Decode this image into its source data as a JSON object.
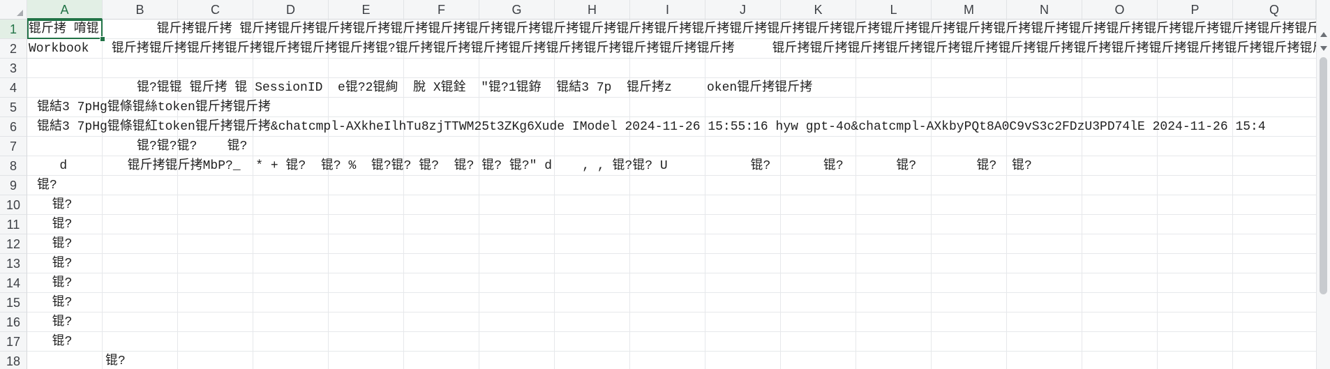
{
  "sheet": {
    "columns": [
      "A",
      "B",
      "C",
      "D",
      "E",
      "F",
      "G",
      "H",
      "I",
      "J",
      "K",
      "L",
      "M",
      "N",
      "O",
      "P",
      "Q"
    ],
    "rows": [
      "1",
      "2",
      "3",
      "4",
      "5",
      "6",
      "7",
      "8",
      "9",
      "10",
      "11",
      "12",
      "13",
      "14",
      "15",
      "16",
      "17",
      "18"
    ],
    "active_column": "A",
    "active_row": "1",
    "cells": {
      "r1_a": "锟斤拷 唷锟",
      "r1_b": "       锟斤拷锟斤拷 锟斤拷锟斤拷锟斤拷锟斤拷锟斤拷锟斤拷锟斤拷锟斤拷锟斤拷锟斤拷锟斤拷锟斤拷锟斤拷锟斤拷锟斤拷锟斤拷锟斤拷锟斤拷锟斤拷锟斤拷锟斤拷锟斤拷锟斤拷锟斤拷锟斤拷锟斤拷锟斤拷锟斤拷锟斤拷锟斤拷锟斤拷锟斤拷",
      "r2_a": "Workbook   锟斤拷锟斤拷锟斤拷锟斤拷锟斤拷锟斤拷锟斤拷锟?锟斤拷锟斤拷锟斤拷锟斤拷锟斤拷锟斤拷锟斤拷锟斤拷锟斤拷     锟斤拷锟斤拷锟斤拷锟斤拷锟斤拷锟斤拷锟斤拷锟斤拷锟斤拷锟斤拷锟斤拷锟斤拷锟斤拷锟斤拷锟斤拷",
      "r4_b": "锟?锟锟 锟斤拷 锟 SessionID  e锟?2锟絢  脫 X锟銓  \"锟?1锟銌  锟結3 7p  锟斤拷z",
      "r4_j": "oken锟斤拷锟斤拷",
      "r5_a": "锟結3 7pHg锟條锟絲token锟斤拷锟斤拷",
      "r6_a": "锟結3 7pHg锟條锟紅token锟斤拷锟斤拷&chatcmpl-AXkheIlhTu8zjTTWM25t3ZKg6Xude IModel 2024-11-26 15:55:16 hyw gpt-4o&chatcmpl-AXkbyPQt8A0C9vS3c2FDzU3PD74lE 2024-11-26 15:4",
      "r7_b": "锟?锟?锟?    锟?",
      "r8_a": "   d        锟斤拷锟斤拷MbP?_  * + 锟?  锟? %  锟?锟? 锟?  锟? 锟? 锟?\" d    , , 锟?锟? U           锟?       锟?       锟?        锟?  锟?",
      "r9_a": "锟?",
      "r10_a": "  锟?",
      "r11_a": "  锟?",
      "r12_a": "  锟?",
      "r13_a": "  锟?",
      "r14_a": "  锟?",
      "r15_a": "  锟?",
      "r16_a": "  锟?",
      "r17_a": "  锟?",
      "r18_b": "锟?"
    }
  },
  "colors": {
    "accent": "#217346",
    "header_bg": "#f5f6f7",
    "gridline": "#e6e8eb"
  },
  "icons": {
    "corner": "select-all-triangle-icon",
    "scroll_up": "scroll-up-icon",
    "scroll_down": "scroll-down-icon"
  }
}
